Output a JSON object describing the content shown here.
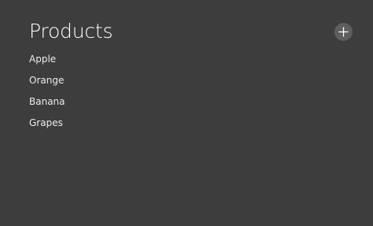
{
  "header": {
    "title": "Products",
    "add_icon": "plus-icon"
  },
  "products": {
    "items": [
      {
        "label": "Apple"
      },
      {
        "label": "Orange"
      },
      {
        "label": "Banana"
      },
      {
        "label": "Grapes"
      }
    ]
  },
  "colors": {
    "background": "#3d3d3d",
    "text": "#ffffff",
    "button_fill": "#5e5e5e"
  }
}
